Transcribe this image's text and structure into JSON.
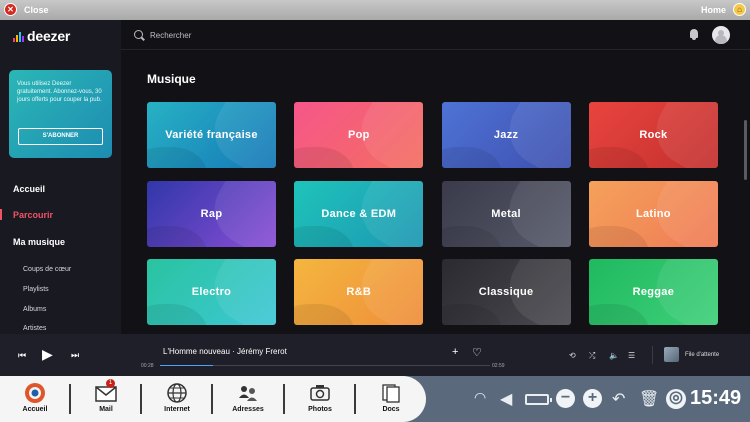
{
  "topbar": {
    "close_label": "Close",
    "home_label": "Home"
  },
  "sidebar": {
    "logo_text": "deezer",
    "promo_text": "Vous utilisez Deezer gratuitement. Abonnez-vous, 30 jours offerts pour couper la pub.",
    "promo_button": "S'ABONNER",
    "main_nav": [
      {
        "label": "Accueil",
        "active": false
      },
      {
        "label": "Parcourir",
        "active": true
      },
      {
        "label": "Ma musique",
        "active": false
      }
    ],
    "sub_nav": [
      "Coups de cœur",
      "Playlists",
      "Albums",
      "Artistes"
    ]
  },
  "search": {
    "placeholder": "Rechercher"
  },
  "section_title": "Musique",
  "genres": [
    {
      "label": "Variété française",
      "colors": [
        "#27b2c4",
        "#1577b8"
      ]
    },
    {
      "label": "Pop",
      "colors": [
        "#f7568a",
        "#f26e5f"
      ]
    },
    {
      "label": "Jazz",
      "colors": [
        "#4e73d6",
        "#3d4fae"
      ]
    },
    {
      "label": "Rock",
      "colors": [
        "#e9443e",
        "#c2302e"
      ]
    },
    {
      "label": "Rap",
      "colors": [
        "#3037a8",
        "#8a4ed6"
      ]
    },
    {
      "label": "Dance & EDM",
      "colors": [
        "#1ec4ba",
        "#1d96b3"
      ]
    },
    {
      "label": "Metal",
      "colors": [
        "#3a3a4a",
        "#565a6a"
      ]
    },
    {
      "label": "Latino",
      "colors": [
        "#f5a15b",
        "#ef7a55"
      ]
    },
    {
      "label": "Electro",
      "colors": [
        "#29c4a0",
        "#3ec7d6"
      ]
    },
    {
      "label": "R&B",
      "colors": [
        "#f4b63f",
        "#ef8d3a"
      ]
    },
    {
      "label": "Classique",
      "colors": [
        "#2a2a30",
        "#4a4a50"
      ]
    },
    {
      "label": "Reggae",
      "colors": [
        "#1fb960",
        "#3fd07a"
      ]
    }
  ],
  "player": {
    "track": "L'Homme nouveau · Jérémy Frerot",
    "elapsed": "00:28",
    "duration": "02:59",
    "progress": 0.16,
    "queue_label": "File d'attente"
  },
  "dock": {
    "items": [
      {
        "label": "Accueil",
        "icon": "home-icon"
      },
      {
        "label": "Mail",
        "icon": "mail-icon",
        "badge": "1"
      },
      {
        "label": "Internet",
        "icon": "globe-icon"
      },
      {
        "label": "Adresses",
        "icon": "contacts-icon"
      },
      {
        "label": "Photos",
        "icon": "camera-icon"
      },
      {
        "label": "Docs",
        "icon": "docs-icon"
      }
    ],
    "clock": "15:49"
  },
  "colors": {
    "accent": "#ef5466",
    "app_bg": "#121216",
    "sidebar_bg": "#191922",
    "dock_bg": "#5a6a7c"
  }
}
